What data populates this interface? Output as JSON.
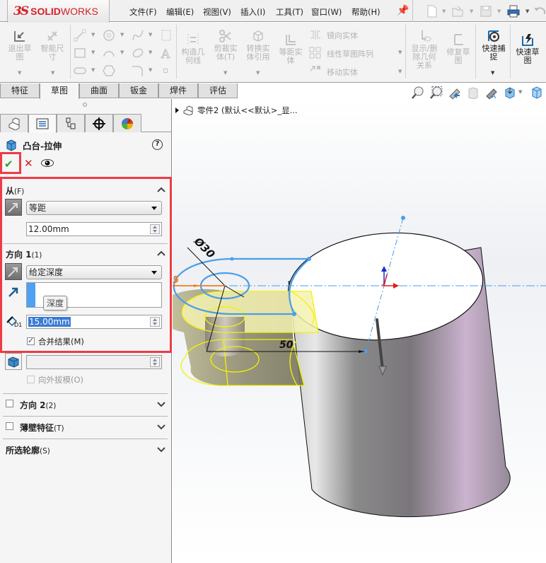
{
  "app": {
    "logo_prefix": "3S",
    "logo_bold": "SOLID",
    "logo_light": "WORKS"
  },
  "menu": [
    "文件(F)",
    "编辑(E)",
    "视图(V)",
    "插入(I)",
    "工具(T)",
    "窗口(W)",
    "帮助(H)"
  ],
  "quick_access": [
    "new-document",
    "open",
    "save",
    "print",
    "undo"
  ],
  "commands": {
    "exit_sketch": "退出草\n图",
    "smart_dimension": "智能尺\n寸",
    "construction_geometry": "构造几\n何线",
    "trim_entities": "剪裁实\n体(T)",
    "convert_entities": "转换实\n体引用",
    "offset_entities": "等距实\n体",
    "mirror_entities": "镜向实体",
    "linear_pattern": "线性草图阵列",
    "move_entities": "移动实体",
    "display_delete_relations": "显示/删\n除几何\n关系",
    "repair_sketch": "修复草\n图",
    "quick_snaps": "快速捕\n捉",
    "rapid_sketch": "快速草\n图"
  },
  "tabs": [
    {
      "label": "特征",
      "active": false
    },
    {
      "label": "草图",
      "active": true
    },
    {
      "label": "曲面",
      "active": false
    },
    {
      "label": "钣金",
      "active": false
    },
    {
      "label": "焊件",
      "active": false
    },
    {
      "label": "评估",
      "active": false
    }
  ],
  "property_manager": {
    "title": "凸台-拉伸",
    "from": {
      "title": "从",
      "shortcut": "(F)",
      "type": "等距",
      "offset": "12.00mm"
    },
    "direction1": {
      "title": "方向 1",
      "shortcut": "(1)",
      "end_condition": "给定深度",
      "tooltip": "深度",
      "depth": "15.00mm",
      "merge_result_label": "合并结果(M)",
      "merge_result": true,
      "draft_outward_label": "向外拔模(O)",
      "draft_outward": false
    },
    "direction2": {
      "title": "方向 2",
      "shortcut": "(2)",
      "checked": false
    },
    "thin_feature": {
      "title": "薄壁特征",
      "shortcut": "(T)",
      "checked": false
    },
    "selected_contours": {
      "title": "所选轮廓",
      "shortcut": "(S)"
    }
  },
  "viewport": {
    "tree_item": "零件2  (默认<<默认>_显...",
    "dimensions": {
      "diameter": "Ø30",
      "length": "50",
      "offset_partial": "5"
    },
    "colors": {
      "sketch_blue": "#4a9ee8",
      "preview_yellow": "#f5f200",
      "dimension_orange": "#f07d1a",
      "highlight_red": "#ee3b45"
    }
  }
}
